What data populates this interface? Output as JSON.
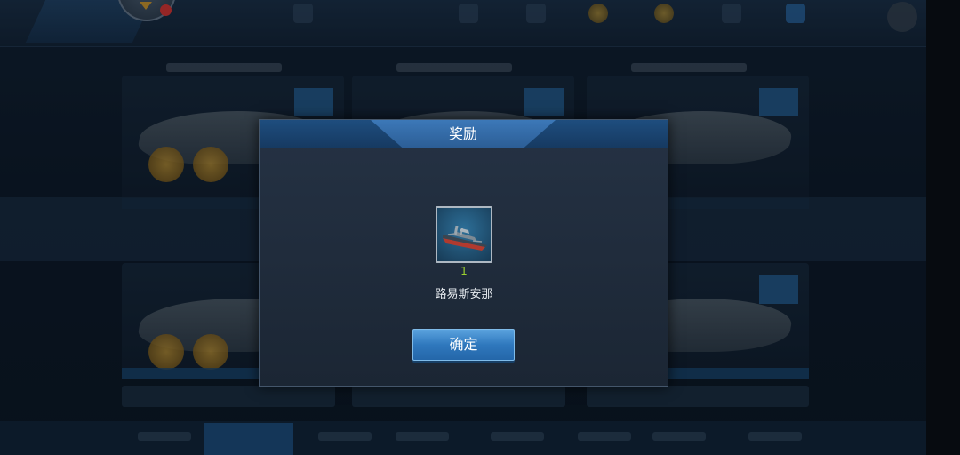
{
  "dialog": {
    "title": "奖励",
    "reward": {
      "item_icon": "battleship-icon",
      "count": "1",
      "name": "路易斯安那"
    },
    "confirm_label": "确定"
  },
  "colors": {
    "dialog_header": "#1e4d7e",
    "title_tab": "#3c78b8",
    "button": "#2f78bd",
    "count_text": "#9bd12f",
    "notification_dot": "#e53b3b"
  }
}
